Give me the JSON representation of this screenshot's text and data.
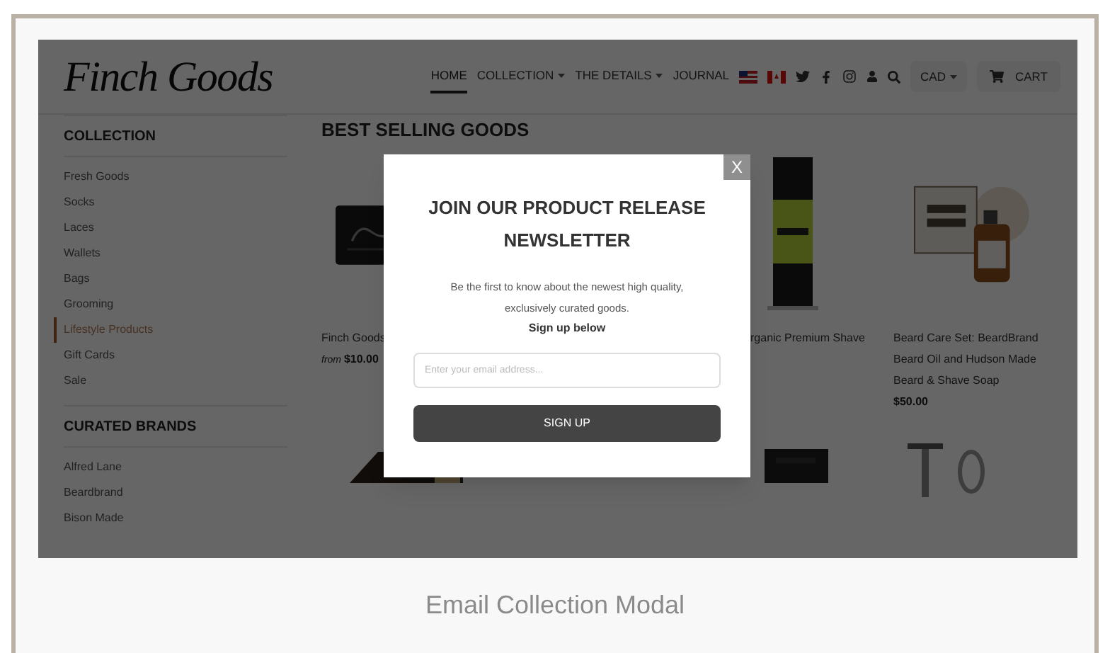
{
  "site": {
    "logo": "Finch Goods",
    "nav": [
      {
        "label": "HOME",
        "selected": true,
        "dropdown": false
      },
      {
        "label": "COLLECTION",
        "selected": false,
        "dropdown": true
      },
      {
        "label": "THE DETAILS",
        "selected": false,
        "dropdown": true
      },
      {
        "label": "JOURNAL",
        "selected": false,
        "dropdown": false
      }
    ],
    "currency": "CAD",
    "cart": "CART"
  },
  "sidebar": [
    {
      "title": "COLLECTION",
      "items": [
        {
          "label": "Fresh Goods",
          "selected": false
        },
        {
          "label": "Socks",
          "selected": false
        },
        {
          "label": "Laces",
          "selected": false
        },
        {
          "label": "Wallets",
          "selected": false
        },
        {
          "label": "Bags",
          "selected": false
        },
        {
          "label": "Grooming",
          "selected": false
        },
        {
          "label": "Lifestyle Products",
          "selected": true
        },
        {
          "label": "Gift Cards",
          "selected": false
        },
        {
          "label": "Sale",
          "selected": false
        }
      ]
    },
    {
      "title": "CURATED BRANDS",
      "items": [
        {
          "label": "Alfred Lane",
          "selected": false
        },
        {
          "label": "Beardbrand",
          "selected": false
        },
        {
          "label": "Bison Made",
          "selected": false
        }
      ]
    }
  ],
  "main": {
    "heading": "BEST SELLING GOODS",
    "products": [
      {
        "lines": [
          "Finch Goods"
        ],
        "price_prefix": "from",
        "price": "$10.00"
      },
      {
        "lines": [
          "rganic Premium Shave"
        ]
      },
      {
        "lines": [
          "Beard Care Set: BeardBrand",
          "Beard Oil and Hudson Made",
          "Beard & Shave Soap"
        ],
        "price": "$50.00"
      }
    ]
  },
  "modal": {
    "close": "X",
    "title": "JOIN OUR PRODUCT RELEASE NEWSLETTER",
    "text": "Be the first to know about the newest high quality, exclusively curated goods.",
    "subtext": "Sign up below",
    "email": {
      "placeholder": "Enter your email address..."
    },
    "button": "SIGN UP"
  },
  "caption": "Email Collection Modal"
}
